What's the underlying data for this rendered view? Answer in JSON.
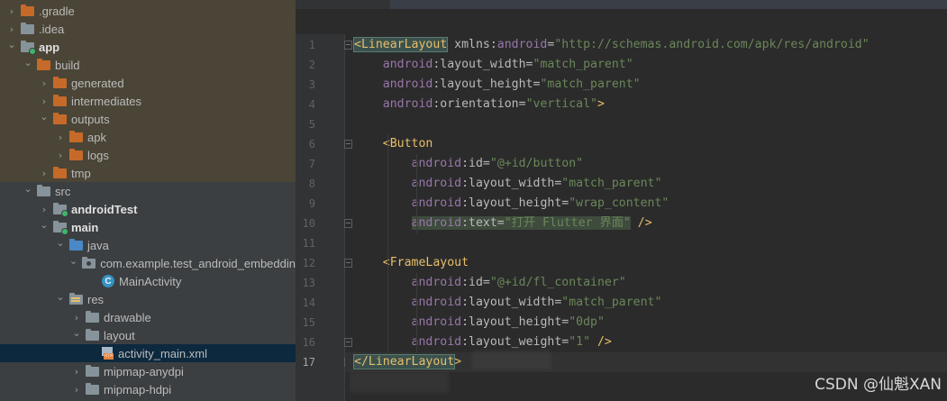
{
  "tree": [
    {
      "label": ".gradle",
      "icon": "folder-icon",
      "color": "orange",
      "indent": 0,
      "arrow": "right",
      "bold": false
    },
    {
      "label": ".idea",
      "icon": "folder-icon",
      "color": "grey",
      "indent": 0,
      "arrow": "right",
      "bold": false
    },
    {
      "label": "app",
      "icon": "module-folder-icon",
      "color": "grey",
      "indent": 0,
      "arrow": "down",
      "bold": true
    },
    {
      "label": "build",
      "icon": "folder-icon",
      "color": "orange",
      "indent": 1,
      "arrow": "down",
      "bold": false
    },
    {
      "label": "generated",
      "icon": "folder-icon",
      "color": "orange",
      "indent": 2,
      "arrow": "right",
      "bold": false
    },
    {
      "label": "intermediates",
      "icon": "folder-icon",
      "color": "orange",
      "indent": 2,
      "arrow": "right",
      "bold": false
    },
    {
      "label": "outputs",
      "icon": "folder-icon",
      "color": "orange",
      "indent": 2,
      "arrow": "down",
      "bold": false
    },
    {
      "label": "apk",
      "icon": "folder-icon",
      "color": "orange",
      "indent": 3,
      "arrow": "right",
      "bold": false
    },
    {
      "label": "logs",
      "icon": "folder-icon",
      "color": "orange",
      "indent": 3,
      "arrow": "right",
      "bold": false
    },
    {
      "label": "tmp",
      "icon": "folder-icon",
      "color": "orange",
      "indent": 2,
      "arrow": "right",
      "bold": false
    },
    {
      "label": "src",
      "icon": "folder-icon",
      "color": "grey",
      "indent": 1,
      "arrow": "down",
      "bold": false
    },
    {
      "label": "androidTest",
      "icon": "source-folder-icon",
      "color": "grey",
      "indent": 2,
      "arrow": "right",
      "bold": true
    },
    {
      "label": "main",
      "icon": "source-folder-icon",
      "color": "grey",
      "indent": 2,
      "arrow": "down",
      "bold": true
    },
    {
      "label": "java",
      "icon": "java-folder-icon",
      "color": "blue",
      "indent": 3,
      "arrow": "down",
      "bold": false
    },
    {
      "label": "com.example.test_android_embeddin",
      "icon": "package-icon",
      "color": "grey",
      "indent": 4,
      "arrow": "down",
      "bold": false
    },
    {
      "label": "MainActivity",
      "icon": "class-icon",
      "color": "blue",
      "indent": 5,
      "arrow": "",
      "bold": false
    },
    {
      "label": "res",
      "icon": "resource-folder-icon",
      "color": "grey",
      "indent": 3,
      "arrow": "down",
      "bold": false
    },
    {
      "label": "drawable",
      "icon": "folder-icon",
      "color": "grey",
      "indent": 4,
      "arrow": "right",
      "bold": false
    },
    {
      "label": "layout",
      "icon": "folder-icon",
      "color": "grey",
      "indent": 4,
      "arrow": "down",
      "bold": false
    },
    {
      "label": "activity_main.xml",
      "icon": "xml-file-icon",
      "color": "orange",
      "indent": 5,
      "arrow": "",
      "bold": false,
      "selected": true
    },
    {
      "label": "mipmap-anydpi",
      "icon": "folder-icon",
      "color": "grey",
      "indent": 4,
      "arrow": "right",
      "bold": false
    },
    {
      "label": "mipmap-hdpi",
      "icon": "folder-icon",
      "color": "grey",
      "indent": 4,
      "arrow": "right",
      "bold": false
    }
  ],
  "editor": {
    "line_numbers": [
      "1",
      "2",
      "3",
      "4",
      "5",
      "6",
      "7",
      "8",
      "9",
      "10",
      "11",
      "12",
      "13",
      "14",
      "15",
      "16",
      "17"
    ],
    "current_line": "17",
    "lines": [
      [
        [
          "tg",
          "<LinearLayout"
        ],
        [
          "at",
          " xmlns:"
        ],
        [
          "ns",
          "android"
        ],
        [
          "at",
          "="
        ],
        [
          "vl",
          "\"http://schemas.android.com/apk/res/android\""
        ]
      ],
      [
        [
          "at",
          "    "
        ],
        [
          "ns",
          "android"
        ],
        [
          "at",
          ":layout_width="
        ],
        [
          "vl",
          "\"match_parent\""
        ]
      ],
      [
        [
          "at",
          "    "
        ],
        [
          "ns",
          "android"
        ],
        [
          "at",
          ":layout_height="
        ],
        [
          "vl",
          "\"match_parent\""
        ]
      ],
      [
        [
          "at",
          "    "
        ],
        [
          "ns",
          "android"
        ],
        [
          "at",
          ":orientation="
        ],
        [
          "vl",
          "\"vertical\""
        ],
        [
          "pn",
          ">"
        ]
      ],
      [],
      [
        [
          "at",
          "    "
        ],
        [
          "tg",
          "<Button"
        ]
      ],
      [
        [
          "at",
          "        "
        ],
        [
          "ns",
          "android"
        ],
        [
          "at",
          ":id="
        ],
        [
          "vl",
          "\"@+id/button\""
        ]
      ],
      [
        [
          "at",
          "        "
        ],
        [
          "ns",
          "android"
        ],
        [
          "at",
          ":layout_width="
        ],
        [
          "vl",
          "\"match_parent\""
        ]
      ],
      [
        [
          "at",
          "        "
        ],
        [
          "ns",
          "android"
        ],
        [
          "at",
          ":layout_height="
        ],
        [
          "vl",
          "\"wrap_content\""
        ]
      ],
      [
        [
          "at",
          "        "
        ],
        [
          "ns",
          "android"
        ],
        [
          "at",
          ":text="
        ],
        [
          "vl",
          "\"打开 Flutter 界面\""
        ],
        [
          "pn",
          " />"
        ]
      ],
      [],
      [
        [
          "at",
          "    "
        ],
        [
          "tg",
          "<FrameLayout"
        ]
      ],
      [
        [
          "at",
          "        "
        ],
        [
          "ns",
          "android"
        ],
        [
          "at",
          ":id="
        ],
        [
          "vl",
          "\"@+id/fl_container\""
        ]
      ],
      [
        [
          "at",
          "        "
        ],
        [
          "ns",
          "android"
        ],
        [
          "at",
          ":layout_width="
        ],
        [
          "vl",
          "\"match_parent\""
        ]
      ],
      [
        [
          "at",
          "        "
        ],
        [
          "ns",
          "android"
        ],
        [
          "at",
          ":layout_height="
        ],
        [
          "vl",
          "\"0dp\""
        ]
      ],
      [
        [
          "at",
          "        "
        ],
        [
          "ns",
          "android"
        ],
        [
          "at",
          ":layout_weight="
        ],
        [
          "vl",
          "\"1\""
        ],
        [
          "pn",
          " />"
        ]
      ],
      [
        [
          "tg",
          "</LinearLayout"
        ],
        [
          "pn",
          ">"
        ]
      ]
    ]
  },
  "watermark": "CSDN @仙魁XAN"
}
